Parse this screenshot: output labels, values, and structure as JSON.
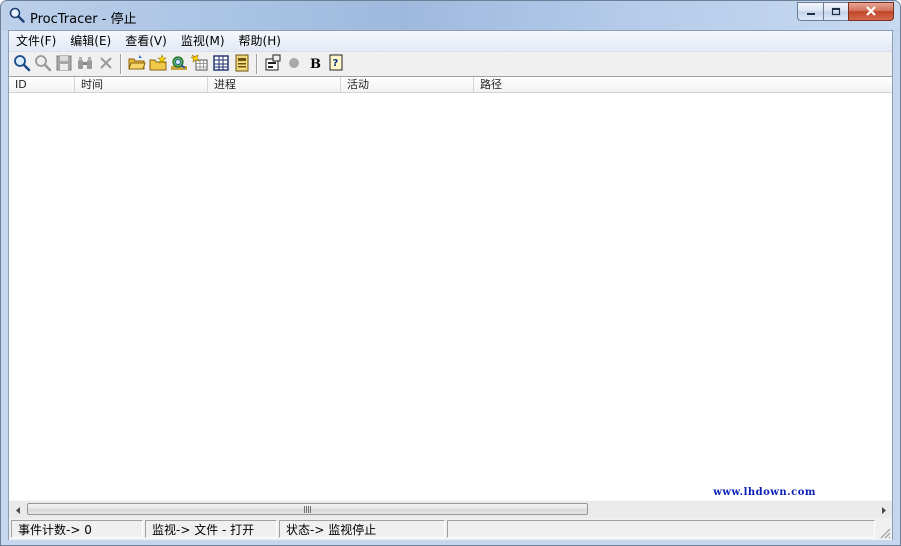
{
  "window": {
    "title": "ProcTracer - 停止",
    "app_icon": "magnifier-icon",
    "buttons": {
      "minimize": "minimize-icon",
      "maximize": "maximize-icon",
      "close": "close-icon"
    }
  },
  "menu": [
    {
      "id": "file",
      "label": "文件(F)"
    },
    {
      "id": "edit",
      "label": "编辑(E)"
    },
    {
      "id": "view",
      "label": "查看(V)"
    },
    {
      "id": "monitor",
      "label": "监视(M)"
    },
    {
      "id": "help",
      "label": "帮助(H)"
    }
  ],
  "toolbar": [
    {
      "name": "start-monitor-button",
      "icon": "magnifier-icon"
    },
    {
      "name": "stop-monitor-button",
      "icon": "magnifier-disabled-icon"
    },
    {
      "name": "save-button",
      "icon": "floppy-disk-icon"
    },
    {
      "name": "find-button",
      "icon": "binoculars-icon"
    },
    {
      "name": "clear-button",
      "icon": "x-icon"
    },
    {
      "sep": true
    },
    {
      "name": "open-folder-button",
      "icon": "open-folder-icon"
    },
    {
      "name": "new-folder-button",
      "icon": "folder-star-icon"
    },
    {
      "name": "capture-button",
      "icon": "globe-magnifier-icon"
    },
    {
      "name": "filter-button",
      "icon": "filter-grid-icon"
    },
    {
      "name": "table-view-button",
      "icon": "table-icon"
    },
    {
      "name": "log-button",
      "icon": "document-icon"
    },
    {
      "sep": true
    },
    {
      "name": "properties-button",
      "icon": "properties-icon"
    },
    {
      "name": "record-button",
      "icon": "record-dot-icon"
    },
    {
      "name": "bold-button",
      "icon": "bold-b-icon"
    },
    {
      "name": "help-button",
      "icon": "help-question-icon"
    }
  ],
  "list": {
    "columns": [
      {
        "id": "id",
        "label": "ID"
      },
      {
        "id": "time",
        "label": "时间"
      },
      {
        "id": "process",
        "label": "进程"
      },
      {
        "id": "activity",
        "label": "活动"
      },
      {
        "id": "path",
        "label": "路径"
      }
    ],
    "rows": []
  },
  "watermark": "www.lhdown.com",
  "scrollbar": {
    "grip_label": "lll"
  },
  "status": {
    "event_count": "事件计数-> 0",
    "monitor": "监视-> 文件 - 打开",
    "state": "状态-> 监视停止",
    "extra": ""
  },
  "colors": {
    "accent_blue": "#0a1fb5",
    "close_red": "#c2462b",
    "icon_blue": "#1a5fb4"
  }
}
